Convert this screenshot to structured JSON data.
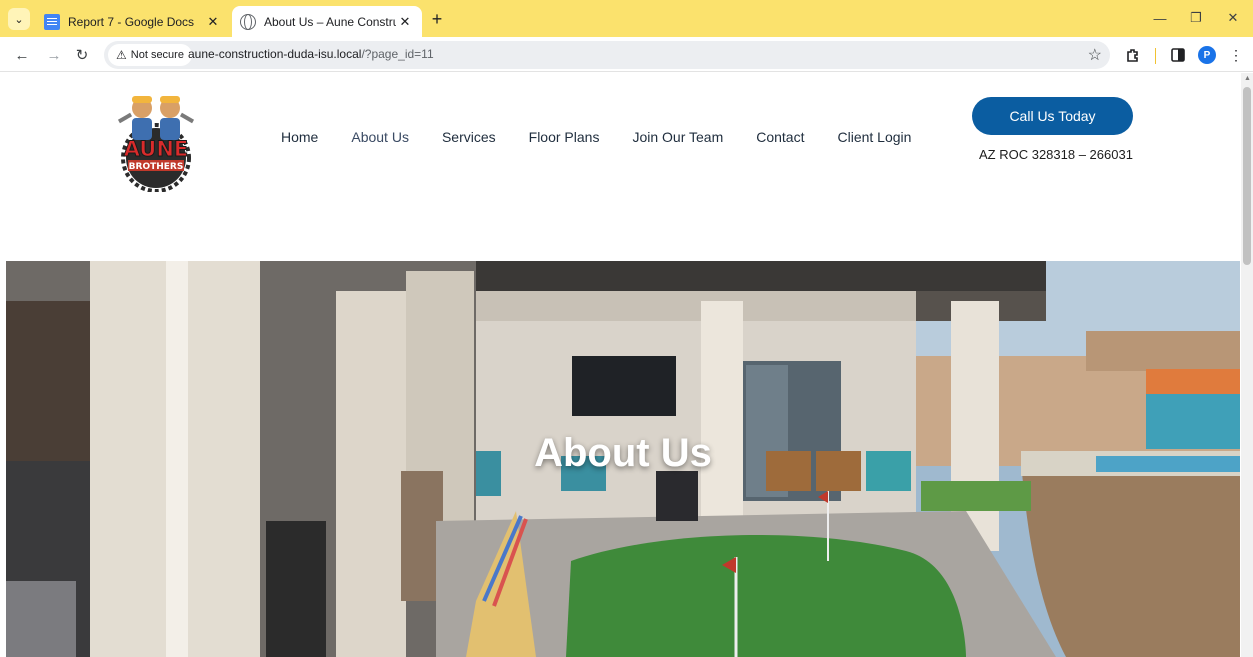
{
  "browser": {
    "tabs": [
      {
        "title": "Report 7 - Google Docs",
        "icon": "google-docs-icon",
        "active": false
      },
      {
        "title": "About Us – Aune Construction",
        "icon": "globe-icon",
        "active": true
      }
    ],
    "security_label": "Not secure",
    "url_host": "aune-construction-duda-isu.local",
    "url_path": "/?page_id=11",
    "profile_initial": "P"
  },
  "site": {
    "logo": {
      "top_text": "AUNE",
      "bottom_text": "BROTHERS"
    },
    "nav": [
      "Home",
      "About Us",
      "Services",
      "Floor Plans",
      "Join Our Team",
      "Contact",
      "Client Login"
    ],
    "current_nav": "About Us",
    "cta_label": "Call Us Today",
    "license": "AZ ROC 328318 – 266031"
  },
  "hero": {
    "title": "About Us"
  },
  "colors": {
    "tabbar": "#fbe26d",
    "cta": "#0b5da1",
    "nav_text": "#1f2d3d"
  }
}
